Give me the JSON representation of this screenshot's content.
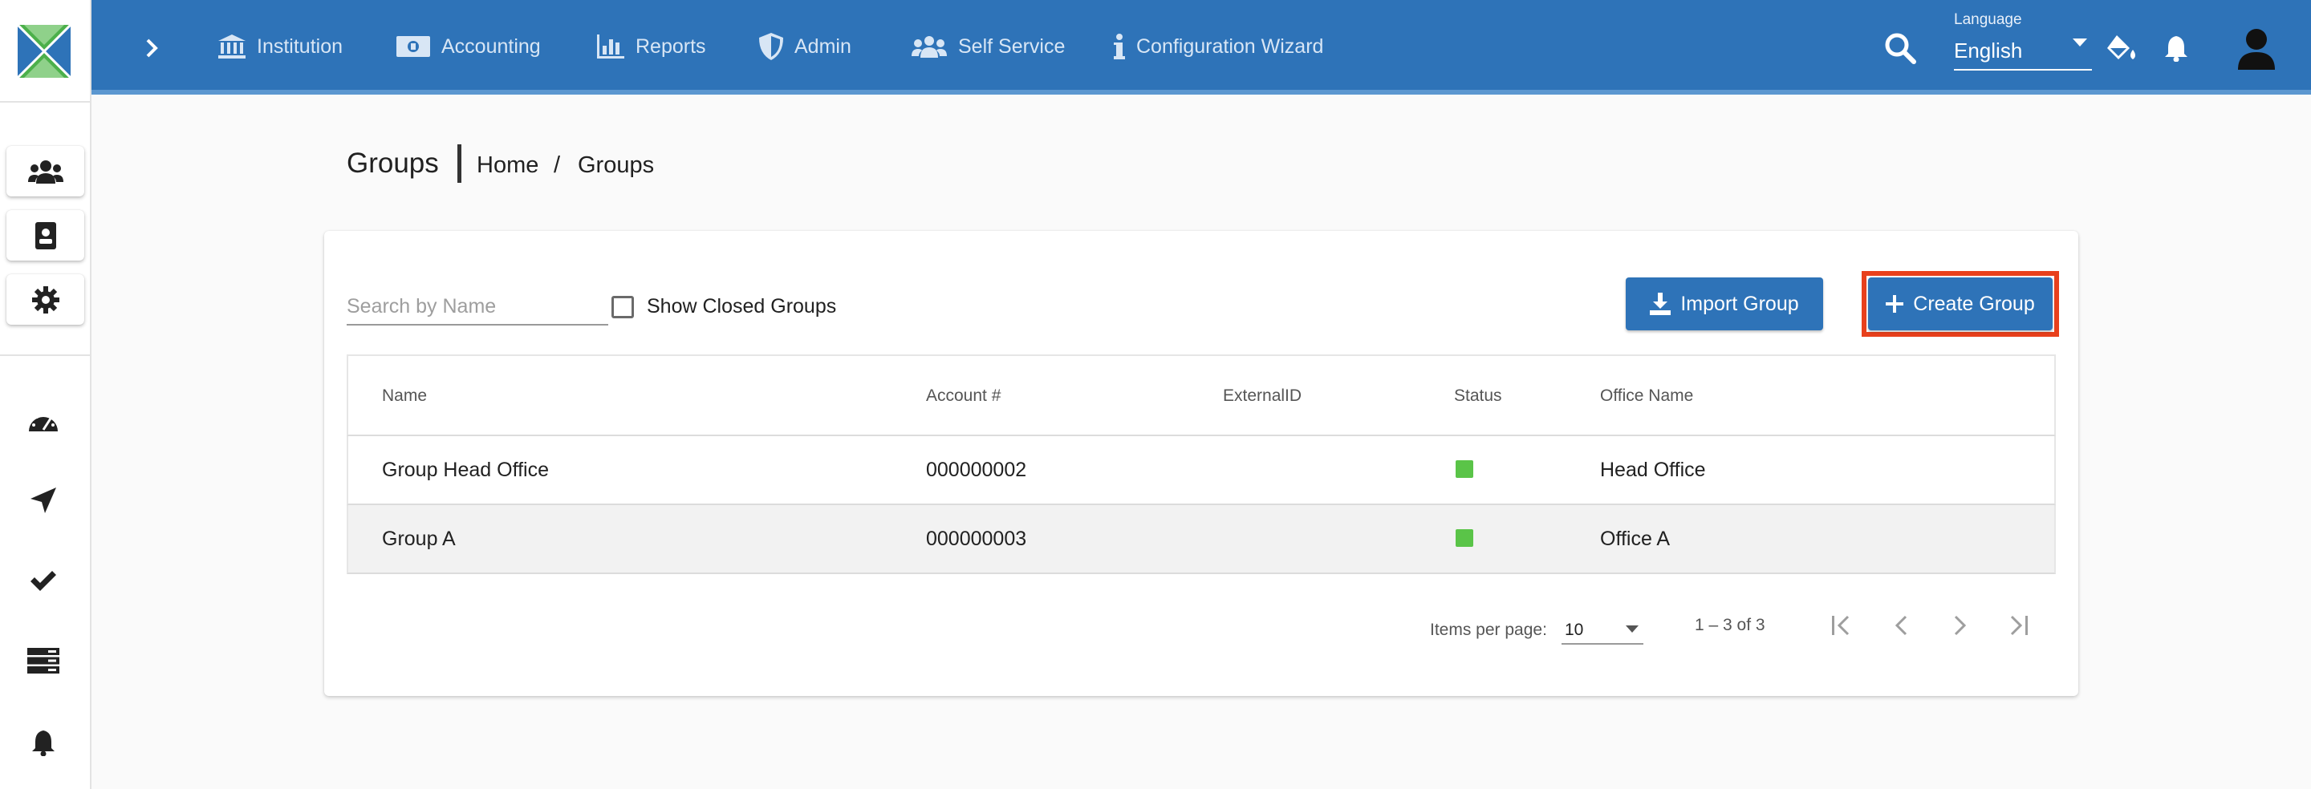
{
  "colors": {
    "primary": "#2e73b8",
    "highlight_border": "#e8401c",
    "status_active": "#5ac448"
  },
  "topbar": {
    "nav": [
      {
        "label": "Institution",
        "icon": "bank-icon"
      },
      {
        "label": "Accounting",
        "icon": "money-icon"
      },
      {
        "label": "Reports",
        "icon": "bar-chart-icon"
      },
      {
        "label": "Admin",
        "icon": "shield-icon"
      },
      {
        "label": "Self Service",
        "icon": "users-icon"
      },
      {
        "label": "Configuration Wizard",
        "icon": "info-icon"
      }
    ],
    "language_label": "Language",
    "language_value": "English"
  },
  "page": {
    "title": "Groups",
    "breadcrumb": {
      "home": "Home",
      "separator": "/",
      "current": "Groups"
    }
  },
  "toolbar": {
    "search_placeholder": "Search by Name",
    "show_closed_label": "Show Closed Groups",
    "import_label": "Import Group",
    "create_label": "Create Group"
  },
  "table": {
    "headers": {
      "name": "Name",
      "account": "Account #",
      "external": "ExternalID",
      "status": "Status",
      "office": "Office Name"
    },
    "rows": [
      {
        "name": "Group Head Office",
        "account": "000000002",
        "external": "",
        "status": "active",
        "office": "Head Office"
      },
      {
        "name": "Group A",
        "account": "000000003",
        "external": "",
        "status": "active",
        "office": "Office A"
      }
    ]
  },
  "paginator": {
    "items_per_page_label": "Items per page:",
    "items_per_page_value": "10",
    "range_label": "1 – 3 of 3"
  }
}
